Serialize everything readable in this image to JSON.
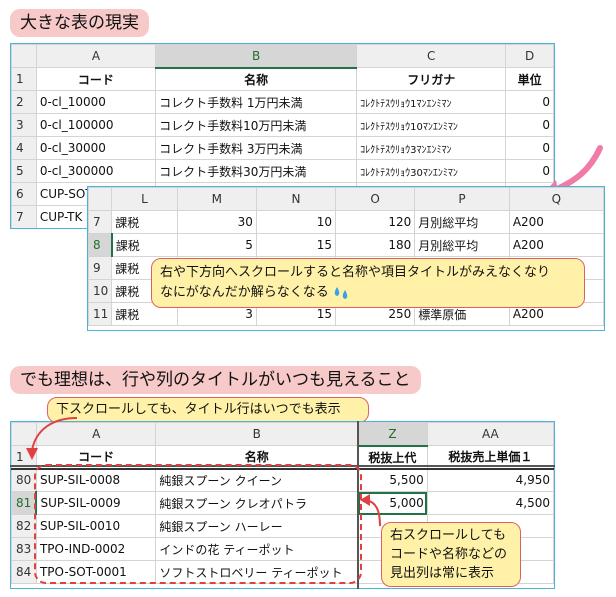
{
  "banner1": "大きな表の現実",
  "banner2": "でも理想は、行や列のタイトルがいつも見えること",
  "sheet1": {
    "columns": [
      "A",
      "B",
      "C",
      "D"
    ],
    "rows": [
      {
        "n": "1",
        "cells": [
          "コード",
          "名称",
          "フリガナ",
          "単位"
        ]
      },
      {
        "n": "2",
        "cells": [
          "0-cl_10000",
          "コレクト手数料 1万円未満",
          "ｺﾚｸﾄﾃｽｳﾘｮｳ1ﾏﾝｴﾝﾐﾏﾝ",
          "0"
        ]
      },
      {
        "n": "3",
        "cells": [
          "0-cl_100000",
          "コレクト手数料10万円未満",
          "ｺﾚｸﾄﾃｽｳﾘｮｳ10ﾏﾝｴﾝﾐﾏﾝ",
          "0"
        ]
      },
      {
        "n": "4",
        "cells": [
          "0-cl_30000",
          "コレクト手数料 3万円未満",
          "ｺﾚｸﾄﾃｽｳﾘｮｳ3ﾏﾝｴﾝﾐﾏﾝ",
          "0"
        ]
      },
      {
        "n": "5",
        "cells": [
          "0-cl_300000",
          "コレクト手数料30万円未満",
          "ｺﾚｸﾄﾃｽｳﾘｮｳ30ﾏﾝｴﾝﾐﾏﾝ",
          "0"
        ]
      },
      {
        "n": "6",
        "cells": [
          "CUP-SOT",
          "",
          "",
          ""
        ]
      },
      {
        "n": "7",
        "cells": [
          "CUP-TK",
          "",
          "",
          ""
        ]
      }
    ]
  },
  "sheet2": {
    "columns": [
      "L",
      "M",
      "N",
      "O",
      "P",
      "Q"
    ],
    "rows": [
      {
        "n": "7",
        "cells": [
          "課税",
          "30",
          "10",
          "120",
          "月別総平均",
          "A200"
        ]
      },
      {
        "n": "8",
        "cells": [
          "課税",
          "5",
          "15",
          "180",
          "月別総平均",
          "A200"
        ]
      },
      {
        "n": "9",
        "cells": [
          "課税",
          "",
          "",
          "",
          "",
          ""
        ]
      },
      {
        "n": "10",
        "cells": [
          "課税",
          "",
          "",
          "",
          "",
          ""
        ]
      },
      {
        "n": "11",
        "cells": [
          "課税",
          "3",
          "15",
          "250",
          "標準原価",
          "A200"
        ]
      }
    ]
  },
  "callout1": {
    "line1": "右や下方向へスクロールすると名称や項目タイトルがみえなくなり",
    "line2": "なにがなんだか解らなくなる"
  },
  "callout2": "下スクロールしても、タイトル行はいつでも表示",
  "sheet3": {
    "columns": [
      "A",
      "B",
      "Z",
      "AA"
    ],
    "header_row": {
      "n": "1",
      "cells": [
        "コード",
        "名称",
        "税抜上代",
        "税抜売上単価１"
      ]
    },
    "rows": [
      {
        "n": "80",
        "cells": [
          "SUP-SIL-0008",
          "純銀スプーン クイーン",
          "5,500",
          "4,950"
        ]
      },
      {
        "n": "81",
        "cells": [
          "SUP-SIL-0009",
          "純銀スプーン クレオパトラ",
          "5,000",
          "4,500"
        ]
      },
      {
        "n": "82",
        "cells": [
          "SUP-SIL-0010",
          "純銀スプーン ハーレー",
          "",
          ""
        ]
      },
      {
        "n": "83",
        "cells": [
          "TPO-IND-0002",
          "インドの花 ティーポット",
          "",
          ""
        ]
      },
      {
        "n": "84",
        "cells": [
          "TPO-SOT-0001",
          "ソフトストロベリー ティーポット",
          "",
          ""
        ]
      }
    ]
  },
  "callout3": {
    "line1": "右スクロールしても",
    "line2": "コードや名称などの",
    "line3": "見出列は常に表示"
  },
  "colors": {
    "accent": "#4bb3d6",
    "banner": "#f7c9c9",
    "callout": "#fff2a8",
    "arrow": "#e04040",
    "selection": "#217346"
  }
}
